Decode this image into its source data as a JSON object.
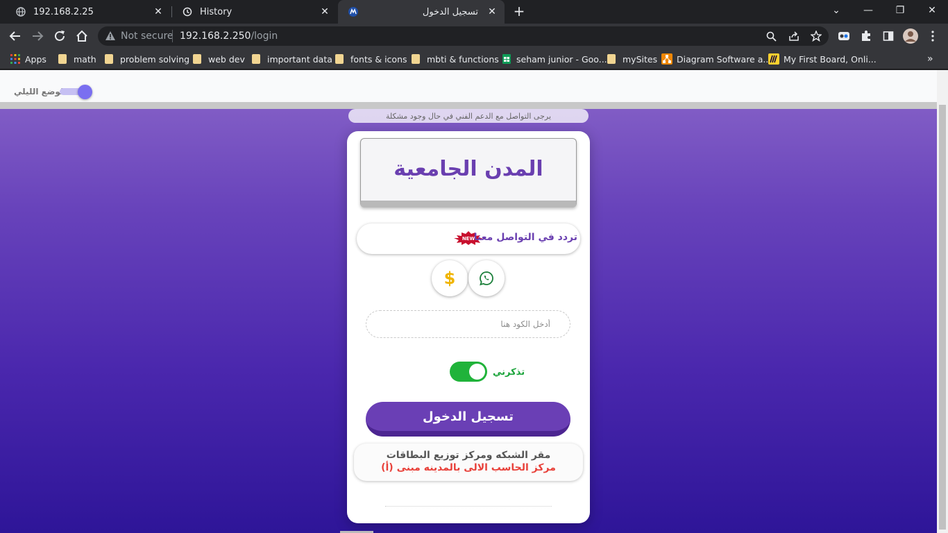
{
  "browser": {
    "tabs": [
      {
        "title": "192.168.2.25",
        "icon": "globe-icon",
        "active": false
      },
      {
        "title": "History",
        "icon": "history-icon",
        "active": false
      },
      {
        "title": "تسجيل الدخول",
        "icon": "site-logo-icon",
        "active": true
      }
    ],
    "close_glyph": "✕",
    "new_tab_glyph": "+",
    "window_controls": {
      "collapse": "⌄",
      "minimize": "—",
      "restore": "❐",
      "close": "✕"
    }
  },
  "toolbar": {
    "not_secure": "Not secure",
    "url_host": "192.168.2.250",
    "url_path": "/login"
  },
  "bookmarks": [
    {
      "label": "Apps",
      "icon": "apps-grid-icon"
    },
    {
      "label": "math",
      "icon": "folder-icon"
    },
    {
      "label": "problem solving",
      "icon": "folder-icon"
    },
    {
      "label": "web dev",
      "icon": "folder-icon"
    },
    {
      "label": "important data",
      "icon": "folder-icon"
    },
    {
      "label": "fonts & icons",
      "icon": "folder-icon"
    },
    {
      "label": "mbti & functions",
      "icon": "folder-icon"
    },
    {
      "label": "seham junior - Goo...",
      "icon": "sheets-icon"
    },
    {
      "label": "mySites",
      "icon": "folder-icon"
    },
    {
      "label": "Diagram Software a...",
      "icon": "diagram-icon"
    },
    {
      "label": "My First Board, Onli...",
      "icon": "miro-icon"
    }
  ],
  "page": {
    "night_mode_label": "الوضع الليلي",
    "ghost_strip_text": "يرجى التواصل مع الدعم الفني في حال وجود مشكلة",
    "logo_text": "المدن الجامعية",
    "contact_text": "تردد في التواصل معنا",
    "new_badge": "NEW",
    "dollar_glyph": "$",
    "code_placeholder": "أدخل الكود هنا",
    "remember_label": "تذكرني",
    "login_button": "تسجيل الدخول",
    "info_line1": "مقر الشبكه ومركز توزيع البطاقات",
    "info_line2": "مركز الحاسب الالى بالمدينه مبنى (أ)"
  },
  "colors": {
    "accent_purple": "#6a3fb0",
    "switch_green": "#20b33a",
    "info_red": "#e8413a"
  }
}
